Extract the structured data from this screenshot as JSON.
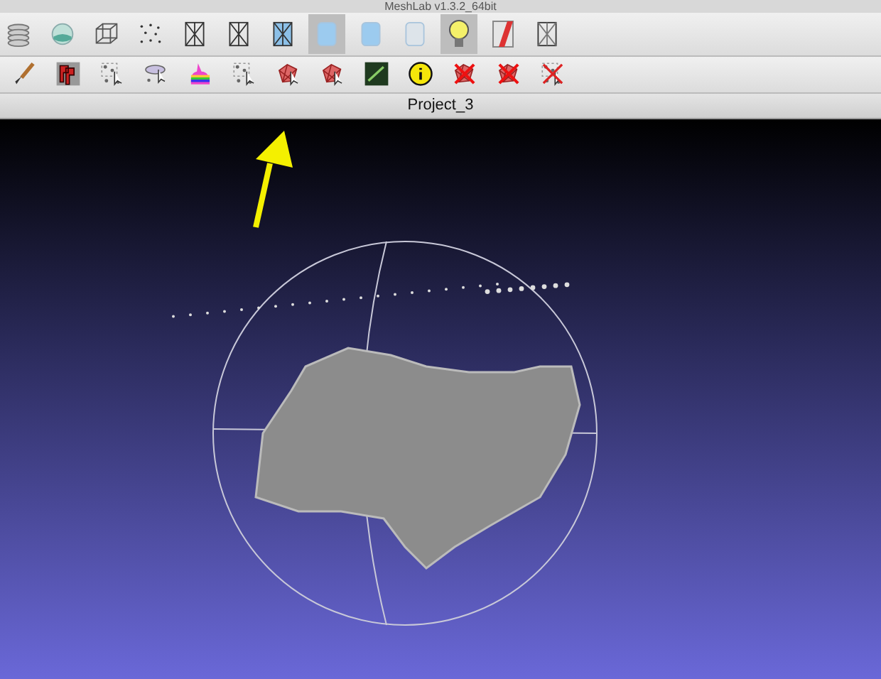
{
  "window": {
    "title": "MeshLab v1.3.2_64bit"
  },
  "render_toolbar": [
    {
      "kind": "layers",
      "selected": false
    },
    {
      "kind": "globe",
      "selected": false
    },
    {
      "kind": "box",
      "selected": false
    },
    {
      "kind": "points",
      "selected": false
    },
    {
      "kind": "wire",
      "selected": false
    },
    {
      "kind": "hidden",
      "selected": false
    },
    {
      "kind": "flatlines",
      "selected": false
    },
    {
      "kind": "flat",
      "selected": true
    },
    {
      "kind": "smooth",
      "selected": false
    },
    {
      "kind": "texture",
      "selected": false
    },
    {
      "kind": "light",
      "selected": true
    },
    {
      "kind": "facecolor",
      "selected": false
    },
    {
      "kind": "selwire",
      "selected": false
    }
  ],
  "edit_toolbar": [
    {
      "kind": "brush"
    },
    {
      "kind": "pp"
    },
    {
      "kind": "selvert"
    },
    {
      "kind": "selconn"
    },
    {
      "kind": "rainbow"
    },
    {
      "kind": "selrect"
    },
    {
      "kind": "selface"
    },
    {
      "kind": "selface"
    },
    {
      "kind": "raster"
    },
    {
      "kind": "info"
    },
    {
      "kind": "delete"
    },
    {
      "kind": "delete"
    },
    {
      "kind": "deletevert"
    }
  ],
  "tab": {
    "label": "Project_3"
  },
  "annotation": {
    "kind": "arrow"
  }
}
